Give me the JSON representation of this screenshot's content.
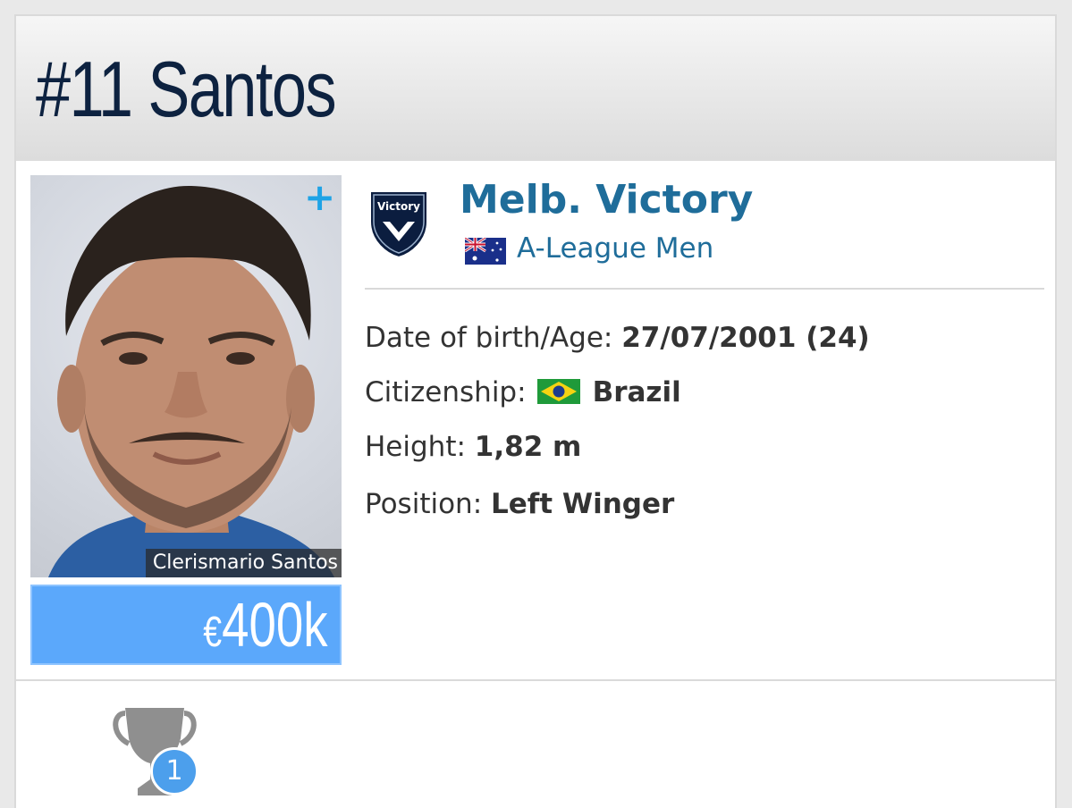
{
  "header": {
    "title": "#11 Santos"
  },
  "player": {
    "photo_caption": "Clerismario Santos",
    "market_value_currency": "€",
    "market_value_amount": "400k"
  },
  "club": {
    "name": "Melb. Victory",
    "logo_icon": "melbourne-victory-crest-icon",
    "logo_text": "Victory",
    "league_name": "A-League Men",
    "league_flag_icon": "australia-flag-icon"
  },
  "info": {
    "dob_label": "Date of birth/Age:",
    "dob_value": "27/07/2001 (24)",
    "citizenship_label": "Citizenship:",
    "citizenship_value": "Brazil",
    "citizenship_flag_icon": "brazil-flag-icon",
    "height_label": "Height:",
    "height_value": "1,82 m",
    "position_label": "Position:",
    "position_value": "Left Winger"
  },
  "achievements": {
    "trophy_icon": "trophy-icon",
    "trophy_count": "1"
  },
  "colors": {
    "title": "#0d2240",
    "club_link": "#1f6d9a",
    "value_box": "#5ba8fb",
    "plus_icon": "#1ea3e6",
    "badge": "#4c9fec"
  }
}
